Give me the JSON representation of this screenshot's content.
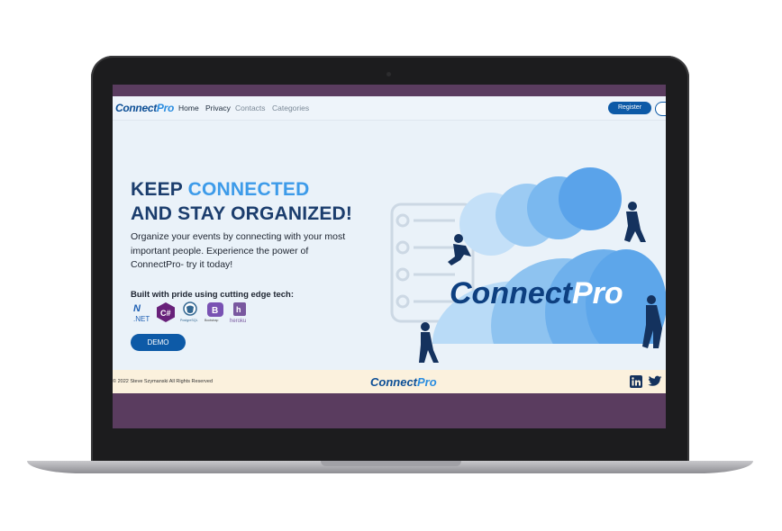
{
  "navbar": {
    "brand_main": "Connect",
    "brand_accent": "Pro",
    "links": [
      "Home",
      "Privacy",
      "Contacts",
      "Categories"
    ],
    "register_label": "Register"
  },
  "hero": {
    "line1_main": "KEEP ",
    "line1_accent": "CONNECTED",
    "line2": "AND STAY ORGANIZED!",
    "paragraph": "Organize your events by connecting with your most important people. Experience the power of ConnectPro- try it today!",
    "tech_title": "Built with pride using cutting edge tech:",
    "tech": [
      ".NET",
      "C#",
      "PostgreSQL",
      "Bootstrap",
      "heroku"
    ],
    "demo_label": "DEMO",
    "illustration_brand_main": "Connect",
    "illustration_brand_accent": "Pro"
  },
  "footer": {
    "copyright": "© 2022 Steve Szymanski All Rights Reserved",
    "brand_main": "Connect",
    "brand_accent": "Pro",
    "social": [
      "linkedin-icon",
      "twitter-icon"
    ]
  },
  "colors": {
    "primary": "#0d5aa7",
    "accent": "#3d9be9",
    "heading": "#1b3d6d",
    "screen_frame": "#5a3c5f",
    "footer_bg": "#fbf1dd"
  }
}
